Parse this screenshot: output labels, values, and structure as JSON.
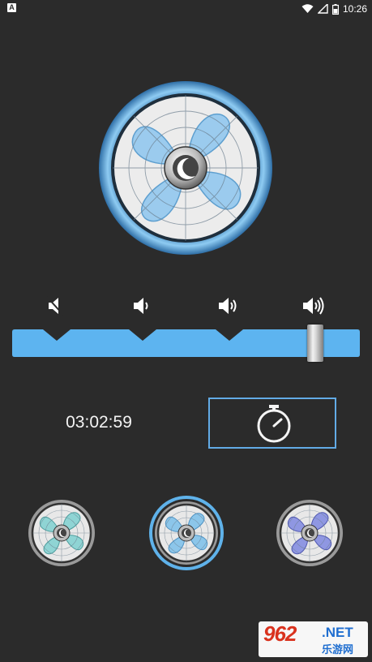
{
  "status_bar": {
    "left_icon_letter": "A",
    "time": "10:26",
    "icons": [
      "wifi-icon",
      "signal-icon",
      "battery-icon"
    ]
  },
  "main_fan": {
    "icon": "fan-icon",
    "center_icon": "moon-icon"
  },
  "speed_levels": [
    {
      "icon": "volume-mute-icon"
    },
    {
      "icon": "volume-low-icon"
    },
    {
      "icon": "volume-medium-icon"
    },
    {
      "icon": "volume-high-icon"
    }
  ],
  "slider": {
    "selected_level": 4,
    "level_count": 4,
    "accent_color": "#5db4f0"
  },
  "timer": {
    "readout": "03:02:59",
    "button_icon": "stopwatch-icon"
  },
  "fan_styles": [
    {
      "icon": "fan-style-teal-icon",
      "selected": false,
      "blade_color": "#7fd0d0"
    },
    {
      "icon": "fan-style-blue-icon",
      "selected": true,
      "blade_color": "#7bc0ea"
    },
    {
      "icon": "fan-style-purple-icon",
      "selected": false,
      "blade_color": "#7f88e0"
    }
  ],
  "watermark": {
    "number": "962",
    "suffix": ".NET",
    "sub_text": "乐游网"
  },
  "colors": {
    "background": "#2b2b2b",
    "accent": "#62abe6",
    "text": "#f4f4f4"
  }
}
